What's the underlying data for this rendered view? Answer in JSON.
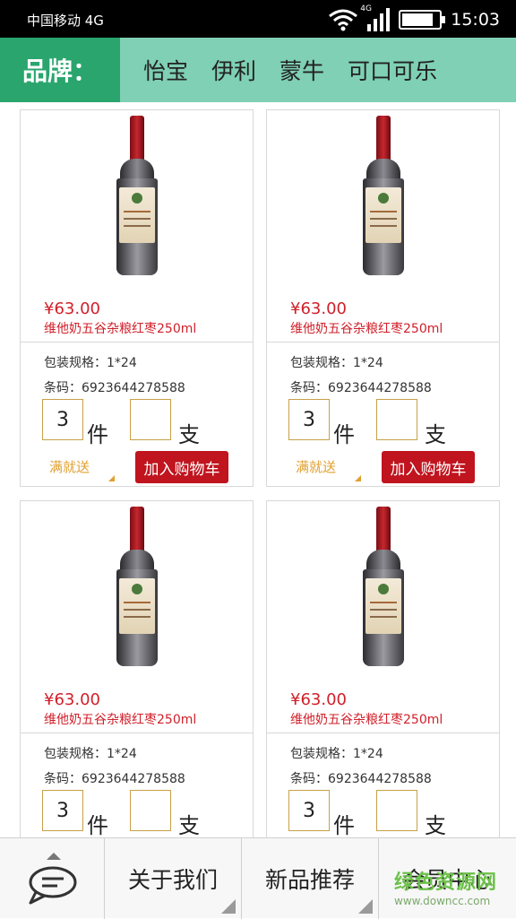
{
  "status_bar": {
    "carrier": "中国移动 4G",
    "network_tag": "4G",
    "time": "15:03",
    "battery_level": 0.85
  },
  "brand_bar": {
    "title": "品牌：",
    "brands": [
      "怡宝",
      "伊利",
      "蒙牛",
      "可口可乐"
    ],
    "accent_color": "#2aa56e",
    "bar_color": "#7fd0b4"
  },
  "products": [
    {
      "price": "¥63.00",
      "name": "维他奶五谷杂粮红枣250ml",
      "spec": "包装规格：1*24",
      "barcode": "条码：6923644278588",
      "qty_case": "3",
      "unit_case": "件",
      "qty_piece": "",
      "unit_piece": "支",
      "promo": "满就送",
      "cart_label": "加入购物车"
    },
    {
      "price": "¥63.00",
      "name": "维他奶五谷杂粮红枣250ml",
      "spec": "包装规格：1*24",
      "barcode": "条码：6923644278588",
      "qty_case": "3",
      "unit_case": "件",
      "qty_piece": "",
      "unit_piece": "支",
      "promo": "满就送",
      "cart_label": "加入购物车"
    },
    {
      "price": "¥63.00",
      "name": "维他奶五谷杂粮红枣250ml",
      "spec": "包装规格：1*24",
      "barcode": "条码：6923644278588",
      "qty_case": "3",
      "unit_case": "件",
      "qty_piece": "",
      "unit_piece": "支"
    },
    {
      "price": "¥63.00",
      "name": "维他奶五谷杂粮红枣250ml",
      "spec": "包装规格：1*24",
      "barcode": "条码：6923644278588",
      "qty_case": "3",
      "unit_case": "件",
      "qty_piece": "",
      "unit_piece": "支"
    }
  ],
  "bottom_nav": {
    "chat_icon": "chat-bubble-icon",
    "about": "关于我们",
    "new_products": "新品推荐",
    "member": "会员中心"
  },
  "watermark": {
    "title": "绿色资源网",
    "url": "www.downcc.com"
  },
  "colors": {
    "price_red": "#d0202a",
    "cart_red": "#c0141e",
    "promo_orange": "#e0a030"
  }
}
